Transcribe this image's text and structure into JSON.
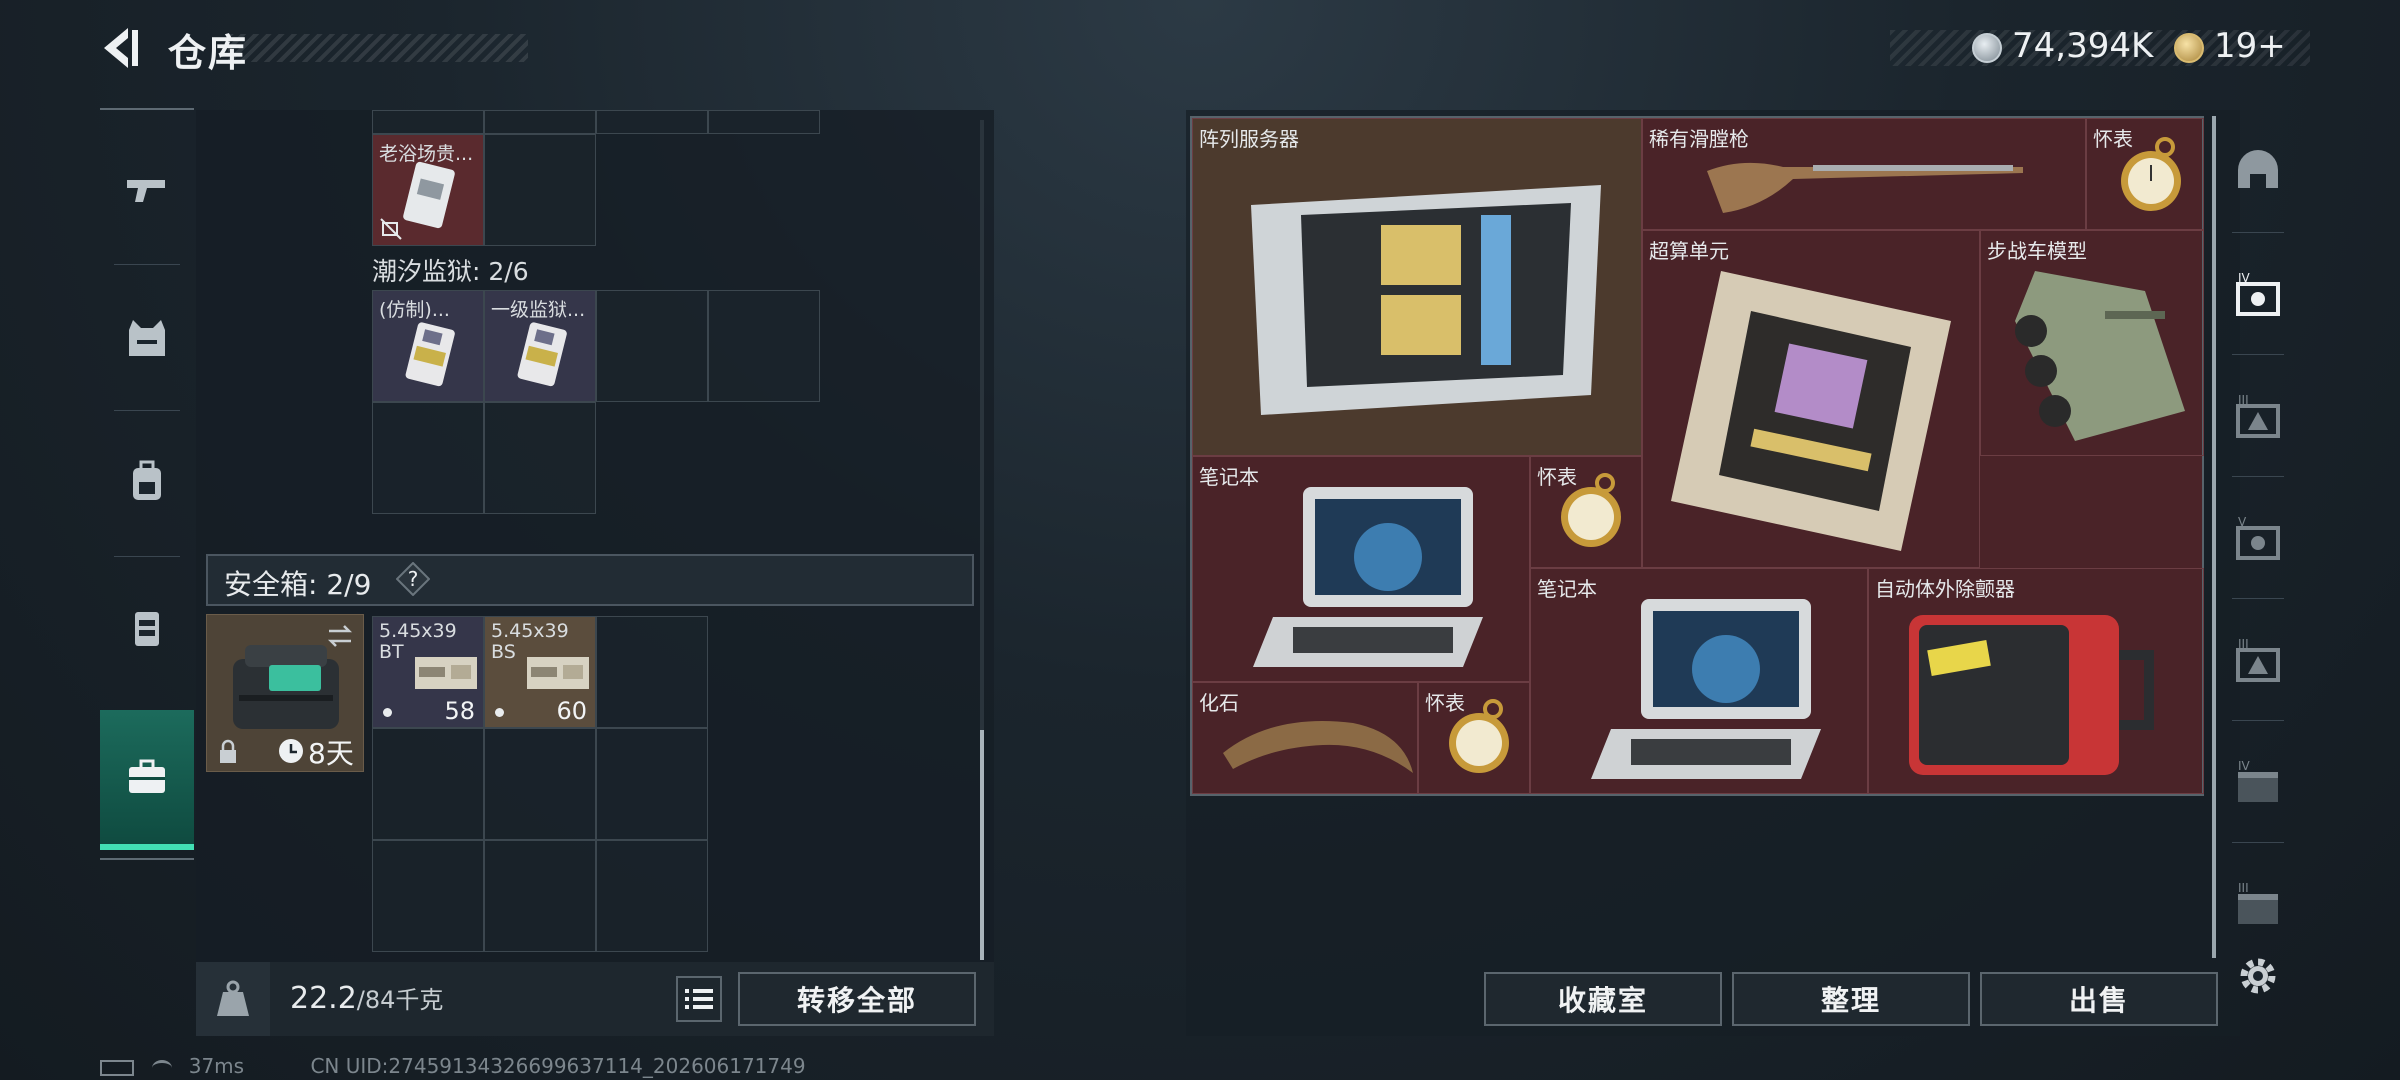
{
  "header": {
    "title": "仓库",
    "silver_amount": "74,394K",
    "gold_amount": "19+"
  },
  "left_nav": {
    "items": [
      "gun-icon",
      "vest-icon",
      "backpack-icon",
      "chest-rig-icon",
      "safebox-icon"
    ],
    "active_index": 4
  },
  "left_panel": {
    "top_item_label": "老浴场贵...",
    "tide_prison": {
      "label": "潮汐监狱: 2/6",
      "items": [
        "(仿制)...",
        "一级监狱..."
      ]
    },
    "safebox": {
      "label": "安全箱: 2/9",
      "help": "?",
      "days": "8天",
      "ammo": [
        {
          "name": "5.45x39 BT",
          "count": "58"
        },
        {
          "name": "5.45x39 BS",
          "count": "60"
        }
      ]
    },
    "footer": {
      "weight_current": "22.2",
      "weight_max": "/84千克",
      "transfer_all": "转移全部"
    }
  },
  "right_panel": {
    "items": [
      {
        "label": "阵列服务器"
      },
      {
        "label": "稀有滑膛枪"
      },
      {
        "label": "怀表"
      },
      {
        "label": "超算单元"
      },
      {
        "label": "步战车模型"
      },
      {
        "label": "笔记本"
      },
      {
        "label": "怀表"
      },
      {
        "label": "笔记本"
      },
      {
        "label": "自动体外除颤器"
      },
      {
        "label": "化石"
      },
      {
        "label": "怀表"
      }
    ],
    "buttons": {
      "collection": "收藏室",
      "organize": "整理",
      "sell": "出售"
    }
  },
  "right_nav": {
    "items": [
      "dome-icon",
      "container-iv-icon",
      "container-iii-icon",
      "container-v-icon",
      "container-iii-b-icon",
      "container-iv-b-icon",
      "container-iii-c-icon",
      "settings-icon"
    ]
  },
  "status": {
    "ping": "37ms",
    "uid": "CN UID:27459134326699637114_202606171749"
  },
  "colors": {
    "accent": "#42e0b4",
    "item_red": "#5a2a2e",
    "item_blue": "#35364a"
  }
}
